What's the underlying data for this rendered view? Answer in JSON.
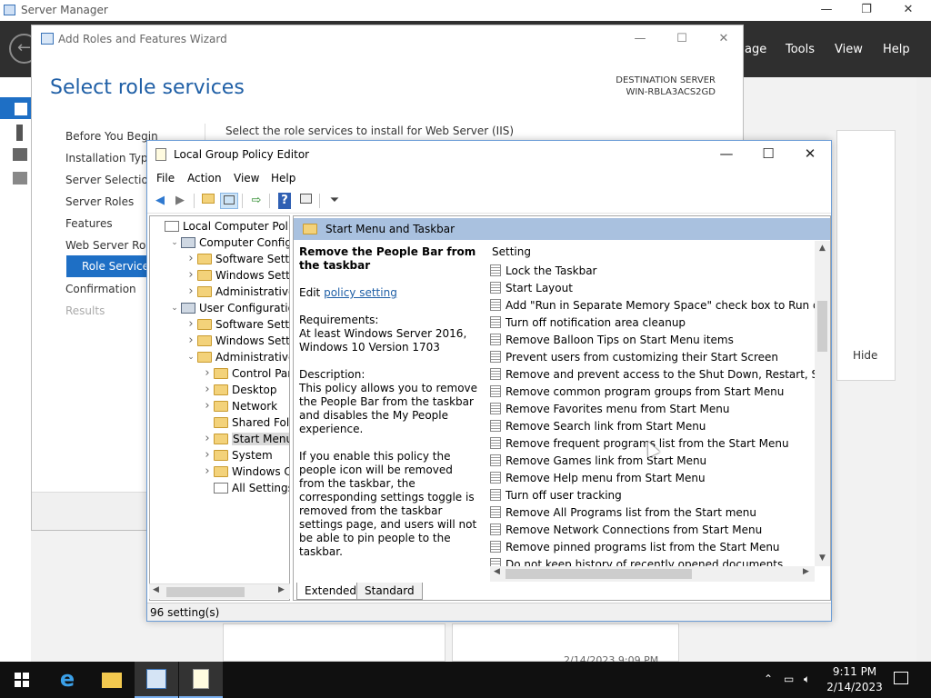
{
  "server_manager": {
    "title": "Server Manager",
    "menus": [
      "age",
      "Tools",
      "View",
      "Help"
    ],
    "hide_label": "Hide",
    "tile_timestamp": "2/14/2023 9:09 PM"
  },
  "wizard": {
    "title": "Add Roles and Features Wizard",
    "heading": "Select role services",
    "destination_label": "DESTINATION SERVER",
    "destination_server": "WIN-RBLA3ACS2GD",
    "instruction": "Select the role services to install for Web Server (IIS)",
    "steps": [
      {
        "label": "Before You Begin",
        "state": "normal"
      },
      {
        "label": "Installation Type",
        "state": "normal"
      },
      {
        "label": "Server Selection",
        "state": "normal"
      },
      {
        "label": "Server Roles",
        "state": "normal"
      },
      {
        "label": "Features",
        "state": "normal"
      },
      {
        "label": "Web Server Role",
        "state": "normal"
      },
      {
        "label": "Role Services",
        "state": "active"
      },
      {
        "label": "Confirmation",
        "state": "normal"
      },
      {
        "label": "Results",
        "state": "disabled"
      }
    ]
  },
  "gpe": {
    "title": "Local Group Policy Editor",
    "menu": [
      "File",
      "Action",
      "View",
      "Help"
    ],
    "tree": [
      {
        "label": "Local Computer Policy",
        "icon": "doc",
        "indent": 0,
        "expander": ""
      },
      {
        "label": "Computer Configura",
        "icon": "computer",
        "indent": 1,
        "expander": "down"
      },
      {
        "label": "Software Settings",
        "icon": "folder",
        "indent": 2,
        "expander": "right"
      },
      {
        "label": "Windows Setting",
        "icon": "folder",
        "indent": 2,
        "expander": "right"
      },
      {
        "label": "Administrative Te",
        "icon": "folder",
        "indent": 2,
        "expander": "right"
      },
      {
        "label": "User Configuration",
        "icon": "computer",
        "indent": 1,
        "expander": "down"
      },
      {
        "label": "Software Settings",
        "icon": "folder",
        "indent": 2,
        "expander": "right"
      },
      {
        "label": "Windows Setting",
        "icon": "folder",
        "indent": 2,
        "expander": "right"
      },
      {
        "label": "Administrative Te",
        "icon": "folder",
        "indent": 2,
        "expander": "down"
      },
      {
        "label": "Control Panel",
        "icon": "folder",
        "indent": 3,
        "expander": "right"
      },
      {
        "label": "Desktop",
        "icon": "folder",
        "indent": 3,
        "expander": "right"
      },
      {
        "label": "Network",
        "icon": "folder",
        "indent": 3,
        "expander": "right"
      },
      {
        "label": "Shared Folder",
        "icon": "folder",
        "indent": 3,
        "expander": ""
      },
      {
        "label": "Start Menu ar",
        "icon": "folder",
        "indent": 3,
        "expander": "right",
        "selected": true
      },
      {
        "label": "System",
        "icon": "folder",
        "indent": 3,
        "expander": "right"
      },
      {
        "label": "Windows Cor",
        "icon": "folder",
        "indent": 3,
        "expander": "right"
      },
      {
        "label": "All Settings",
        "icon": "doc",
        "indent": 3,
        "expander": ""
      }
    ],
    "pane_header": "Start Menu and Taskbar",
    "description": {
      "policy_name": "Remove the People Bar from the taskbar",
      "edit_prefix": "Edit",
      "edit_link": "policy setting",
      "requirements_label": "Requirements:",
      "requirements": "At least Windows Server 2016, Windows 10 Version 1703",
      "description_label": "Description:",
      "description": "This policy allows you to remove the People Bar from the taskbar and disables the My People experience.",
      "details": "If you enable this policy the people icon will be removed from the taskbar, the corresponding settings toggle is removed from the taskbar settings page, and users will not be able to pin people to the taskbar."
    },
    "settings_header": "Setting",
    "settings": [
      "Lock the Taskbar",
      "Start Layout",
      "Add \"Run in Separate Memory Space\" check box to Run dial...",
      "Turn off notification area cleanup",
      "Remove Balloon Tips on Start Menu items",
      "Prevent users from customizing their Start Screen",
      "Remove and prevent access to the Shut Down, Restart, Sleep...",
      "Remove common program groups from Start Menu",
      "Remove Favorites menu from Start Menu",
      "Remove Search link from Start Menu",
      "Remove frequent programs list from the Start Menu",
      "Remove Games link from Start Menu",
      "Remove Help menu from Start Menu",
      "Turn off user tracking",
      "Remove All Programs list from the Start menu",
      "Remove Network Connections from Start Menu",
      "Remove pinned programs list from the Start Menu",
      "Do not keep history of recently opened documents"
    ],
    "tabs": [
      "Extended",
      "Standard"
    ],
    "status": "96 setting(s)"
  },
  "taskbar": {
    "time": "9:11 PM",
    "date": "2/14/2023"
  },
  "colors": {
    "accent": "#1e6fc5",
    "pane_header": "#a9c1df",
    "taskbar": "#101010"
  }
}
